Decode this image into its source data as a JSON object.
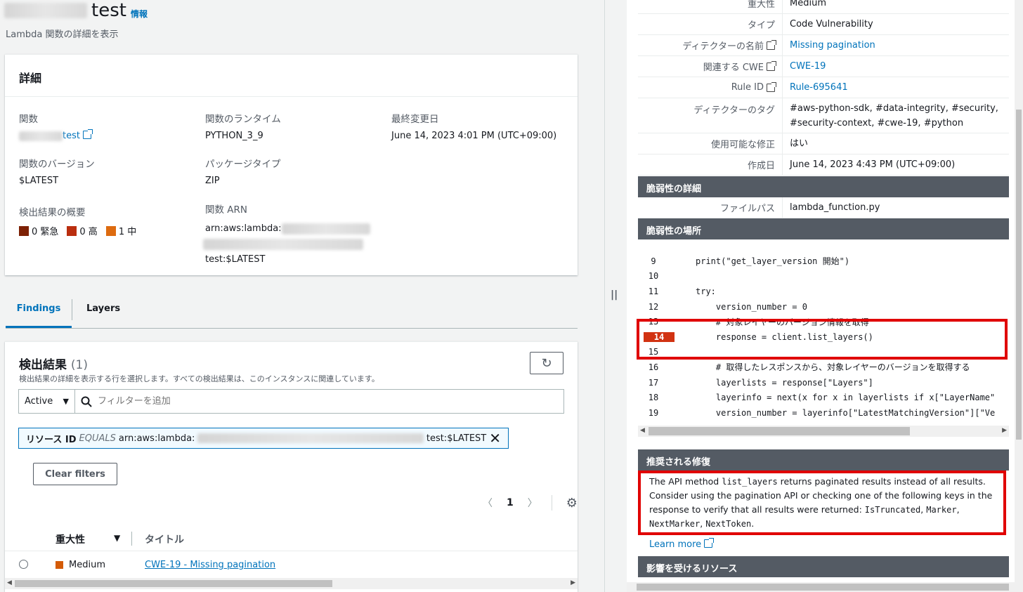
{
  "page": {
    "title": "test",
    "info_link": "情報",
    "subtitle": "Lambda 関数の詳細を表示"
  },
  "details": {
    "header": "詳細",
    "function_label": "関数",
    "function_value": "test",
    "runtime_label": "関数のランタイム",
    "runtime_value": "PYTHON_3_9",
    "modified_label": "最終変更日",
    "modified_value": "June 14, 2023 4:01 PM (UTC+09:00)",
    "version_label": "関数のバージョン",
    "version_value": "$LATEST",
    "package_label": "パッケージタイプ",
    "package_value": "ZIP",
    "summary_label": "検出結果の概要",
    "arn_label": "関数 ARN",
    "arn_line1": "arn:aws:lambda:",
    "arn_line3": "test:$LATEST",
    "severity_summary": [
      {
        "label": "0 緊急",
        "color": "#7d2105"
      },
      {
        "label": "0 高",
        "color": "#ba2e0f"
      },
      {
        "label": "1 中",
        "color": "#dd6b10"
      }
    ]
  },
  "tabs": [
    {
      "label": "Findings",
      "active": true
    },
    {
      "label": "Layers",
      "active": false
    }
  ],
  "findings": {
    "title": "検出結果",
    "count": "(1)",
    "description": "検出結果の詳細を表示する行を選択します。すべての検出結果は、このインスタンスに関連しています。",
    "status_select": "Active",
    "filter_placeholder": "フィルターを追加",
    "token_key": "リソース ID",
    "token_op": "EQUALS",
    "token_prefix": "arn:aws:lambda:",
    "token_suffix": "test:$LATEST",
    "clear_filters": "Clear filters",
    "page_number": "1",
    "col_severity": "重大性",
    "col_title": "タイトル",
    "rows": [
      {
        "severity": "Medium",
        "title": "CWE-19 - Missing pagination"
      }
    ]
  },
  "finding_detail": {
    "severity_label": "重大性",
    "severity_value": "Medium",
    "type_label": "タイプ",
    "type_value": "Code Vulnerability",
    "detector_label": "ディテクターの名前",
    "detector_value": "Missing pagination",
    "cwe_label": "関連する CWE",
    "cwe_value": "CWE-19",
    "rule_label": "Rule ID",
    "rule_value": "Rule-695641",
    "tags_label": "ディテクターのタグ",
    "tags_value": "#aws-python-sdk, #data-integrity, #security, #security-context, #cwe-19, #python",
    "fix_avail_label": "使用可能な修正",
    "fix_avail_value": "はい",
    "created_label": "作成日",
    "created_value": "June 14, 2023 4:43 PM (UTC+09:00)",
    "vuln_details_header": "脆弱性の詳細",
    "filepath_label": "ファイルパス",
    "filepath_value": "lambda_function.py",
    "vuln_location_header": "脆弱性の場所",
    "code_lines": [
      {
        "n": "9",
        "code": "print(\"get_layer_version 開始\")"
      },
      {
        "n": "10",
        "code": ""
      },
      {
        "n": "11",
        "code": "try:"
      },
      {
        "n": "12",
        "code": "    version_number = 0"
      },
      {
        "n": "13",
        "code": "    # 対象レイヤーのバージョン情報を取得"
      },
      {
        "n": "14",
        "code": "    response = client.list_layers()"
      },
      {
        "n": "15",
        "code": ""
      },
      {
        "n": "16",
        "code": "    # 取得したレスポンスから、対象レイヤーのバージョンを取得する"
      },
      {
        "n": "17",
        "code": "    layerlists = response[\"Layers\"]"
      },
      {
        "n": "18",
        "code": "    layerinfo = next(x for x in layerlists if x[\"LayerName\""
      },
      {
        "n": "19",
        "code": "    version_number = layerinfo[\"LatestMatchingVersion\"][\"Ve"
      }
    ],
    "recommended_fix_header": "推奨される修復",
    "fix_text_1": "The API method ",
    "fix_code_1": "list_layers",
    "fix_text_2": " returns paginated results instead of all results. Consider using the pagination API or checking one of the following keys in the response to verify that all results were returned: ",
    "fix_code_2": "IsTruncated",
    "fix_code_3": "Marker",
    "fix_code_4": "NextMarker",
    "fix_code_5": "NextToken",
    "learn_more": "Learn more",
    "affected_header": "影響を受けるリソース"
  }
}
